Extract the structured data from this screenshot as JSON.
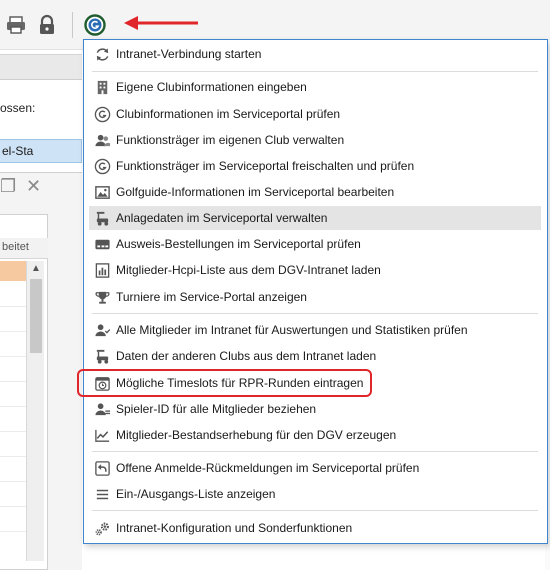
{
  "toolbar": {
    "icons": [
      "printer-icon",
      "lock-icon",
      "golf-g-icon"
    ],
    "annotation_arrow_color": "#e0262a"
  },
  "background": {
    "label": "ossen:",
    "selected_item": "el-Sta",
    "column_header": "beitet",
    "selection_color": "#cfe3f6",
    "row_highlight_color": "#f6c9a0"
  },
  "menu": {
    "border_color": "#3f86cc",
    "items": [
      {
        "label": "Intranet-Verbindung starten",
        "icon": "refresh-icon"
      },
      {
        "label": "Eigene Clubinformationen eingeben",
        "icon": "building-icon"
      },
      {
        "label": "Clubinformationen im Serviceportal prüfen",
        "icon": "golf-g-icon"
      },
      {
        "label": "Funktionsträger im eigenen Club verwalten",
        "icon": "users-icon"
      },
      {
        "label": "Funktionsträger im Serviceportal freischalten und prüfen",
        "icon": "golf-g-icon"
      },
      {
        "label": "Golfguide-Informationen im Serviceportal bearbeiten",
        "icon": "image-icon"
      },
      {
        "label": "Anlagedaten im Serviceportal verwalten",
        "icon": "golf-cart-icon"
      },
      {
        "label": "Ausweis-Bestellungen im Serviceportal prüfen",
        "icon": "id-card-icon"
      },
      {
        "label": "Mitglieder-Hcpi-Liste aus dem DGV-Intranet laden",
        "icon": "bar-list-icon"
      },
      {
        "label": "Turniere im Service-Portal anzeigen",
        "icon": "trophy-icon"
      },
      {
        "label": "Alle Mitglieder im Intranet für Auswertungen und Statistiken prüfen",
        "icon": "user-check-icon"
      },
      {
        "label": "Daten der anderen Clubs aus dem Intranet laden",
        "icon": "golf-cart-icon"
      },
      {
        "label": "Mögliche Timeslots für RPR-Runden eintragen",
        "icon": "calendar-clock-icon"
      },
      {
        "label": "Spieler-ID für alle Mitglieder beziehen",
        "icon": "user-id-icon"
      },
      {
        "label": "Mitglieder-Bestandserhebung für den DGV erzeugen",
        "icon": "line-chart-icon"
      },
      {
        "label": "Offene Anmelde-Rückmeldungen im Serviceportal prüfen",
        "icon": "reply-icon"
      },
      {
        "label": "Ein-/Ausgangs-Liste anzeigen",
        "icon": "list-icon"
      },
      {
        "label": "Intranet-Konfiguration und Sonderfunktionen",
        "icon": "gears-icon"
      }
    ]
  }
}
